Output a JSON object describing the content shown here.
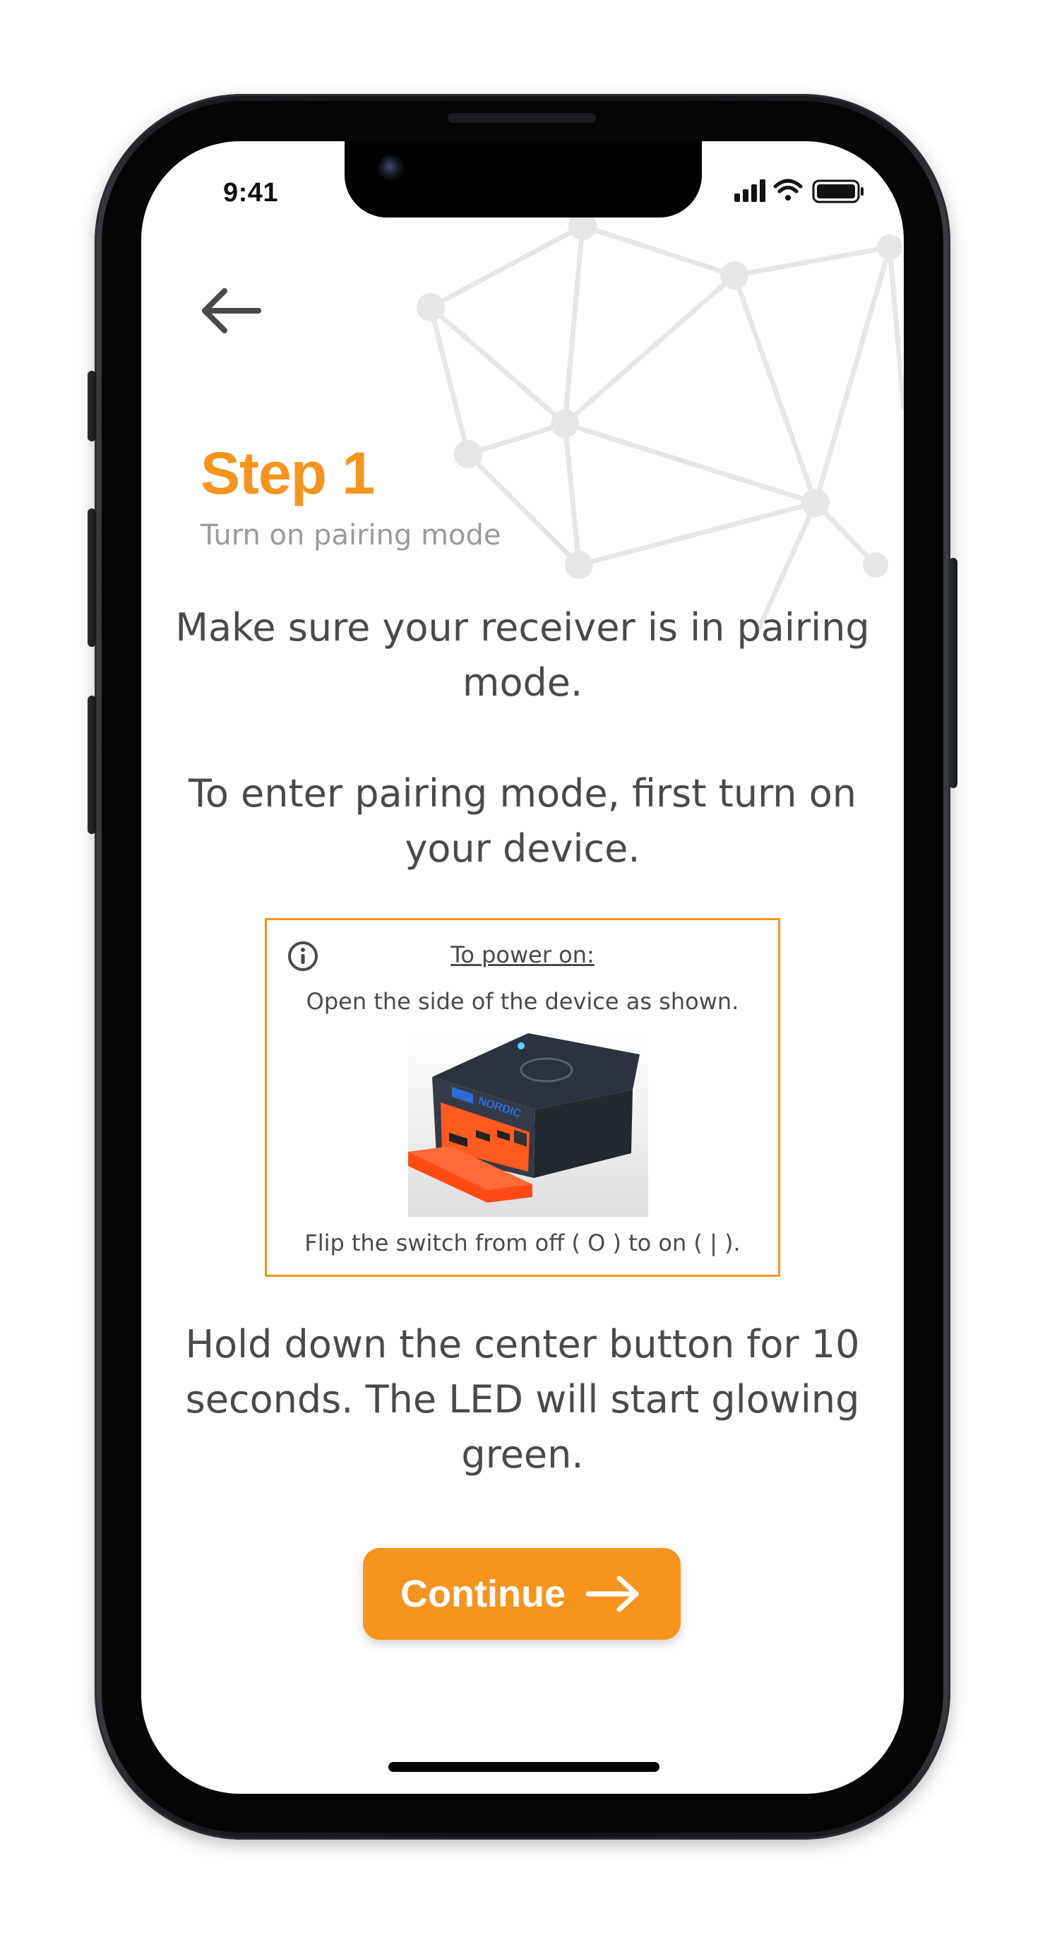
{
  "status_bar": {
    "time": "9:41",
    "icons": [
      "cellular-signal-icon",
      "wifi-icon",
      "battery-icon"
    ]
  },
  "nav": {
    "back_icon": "arrow-left-icon"
  },
  "step": {
    "title": "Step 1",
    "subtitle": "Turn on pairing mode"
  },
  "instructions": {
    "paragraph1": "Make sure your receiver is in pairing mode.",
    "paragraph2": "To enter pairing mode, first turn on your device.",
    "paragraph3": "Hold down the center button for 10 seconds. The LED will start glowing green."
  },
  "info_box": {
    "icon": "info-icon",
    "title": "To power on:",
    "line1": "Open the side of the device as shown.",
    "device_image": "nordic-device-image",
    "device_brand": "NORDIC",
    "line2": "Flip the switch from off ( O ) to on ( | )."
  },
  "continue_button": {
    "label": "Continue",
    "icon": "arrow-right-icon"
  },
  "colors": {
    "accent": "#f7941e",
    "text": "#4a4a4a",
    "subtitle": "#9a9a9a"
  }
}
